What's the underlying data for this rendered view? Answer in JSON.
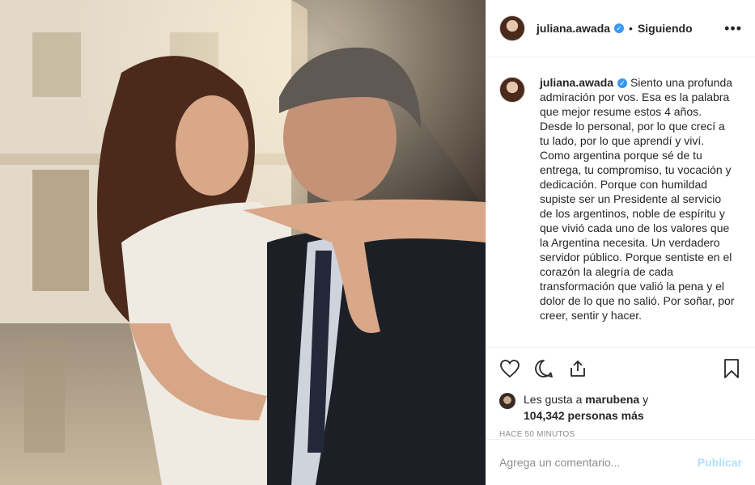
{
  "photo": {
    "description_icon": "photo"
  },
  "header": {
    "username": "juliana.awada",
    "verified_icon": "verified-badge-icon",
    "separator": "•",
    "follow_status": "Siguiendo",
    "more_icon": "•••"
  },
  "caption": {
    "username": "juliana.awada",
    "text": "Siento una profunda admiración por vos. Esa es la palabra que mejor resume estos 4 años. Desde lo personal, por lo que crecí a tu lado, por lo que aprendí y viví. Como argentina porque sé de tu entrega, tu compromiso, tu vocación y dedicación. Porque con humildad supiste ser un Presidente al servicio de los argentinos, noble de espíritu y que vivió cada uno de los valores que la Argentina necesita. Un verdadero servidor público. Porque sentiste en el corazón la alegría de cada transformación que valió la pena y el dolor de lo que no salió. Por soñar, por creer, sentir y hacer."
  },
  "actions": {
    "like_icon": "heart-icon",
    "comment_icon": "comment-icon",
    "share_icon": "share-icon",
    "save_icon": "bookmark-icon"
  },
  "likes": {
    "prefix": "Les gusta a",
    "user": "marubena",
    "conj": "y",
    "count": "104,342 personas más"
  },
  "timestamp": "HACE 50 MINUTOS",
  "comment": {
    "placeholder": "Agrega un comentario...",
    "publish_label": "Publicar"
  },
  "colors": {
    "verified": "#3897f0",
    "publish_disabled": "#b2dffc",
    "muted": "#8e8e8e"
  }
}
